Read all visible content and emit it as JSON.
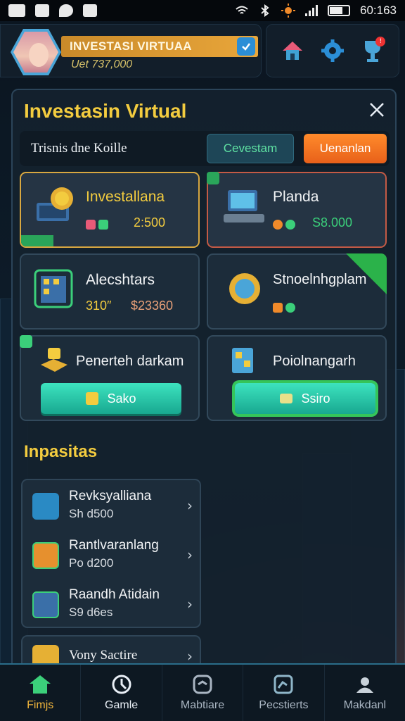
{
  "status_bar": {
    "time": "60:163"
  },
  "player": {
    "name": "INVESTASI VIRTUAA",
    "balance": "Uet 737,000"
  },
  "panel": {
    "title": "Investasin Virtual",
    "filter_label": "Trisnis dne Koille",
    "tab_primary": "Cevestam",
    "tab_secondary": "Uenanlan"
  },
  "cards": [
    {
      "title": "Investallana",
      "stat": "2:500"
    },
    {
      "title": "Planda",
      "stat": "S8.000"
    },
    {
      "title": "Alecshtars",
      "stat_a": "310″",
      "stat_b": "$23360"
    },
    {
      "title": "Stnoelnhgplam"
    },
    {
      "title": "Penerteh darkam",
      "button": "Sako"
    },
    {
      "title": "Poiolnangarh",
      "button": "Ssiro"
    }
  ],
  "section": {
    "title": "Inpasitas",
    "items": [
      {
        "title": "Revksyalliana",
        "sub": "Sh d500"
      },
      {
        "title": "Rantlvaranlang",
        "sub": "Po d200"
      },
      {
        "title": "Raandh Atidain",
        "sub": "S9 d6es"
      },
      {
        "title": "Vony Sactire"
      }
    ]
  },
  "bottom_nav": [
    {
      "label": "Fimjs"
    },
    {
      "label": "Gamle"
    },
    {
      "label": "Mabtiare"
    },
    {
      "label": "Pecstierts"
    },
    {
      "label": "Makdanl"
    }
  ],
  "colors": {
    "accent_gold": "#f3cc3f",
    "accent_green": "#3de3bf",
    "accent_orange": "#ff8b2b",
    "panel_bg": "#14212e"
  }
}
